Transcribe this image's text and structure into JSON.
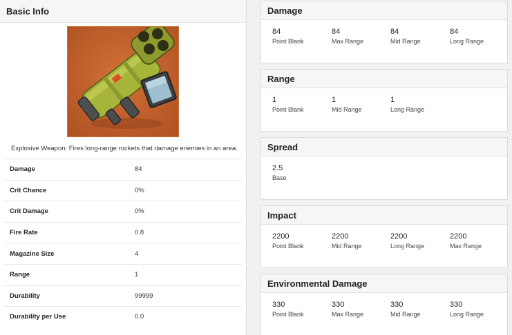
{
  "basic_info": {
    "title": "Basic Info",
    "description": "Explosive Weapon: Fires long-range rockets that damage enemies in an area.",
    "stats": [
      {
        "label": "Damage",
        "value": "84"
      },
      {
        "label": "Crit Chance",
        "value": "0%"
      },
      {
        "label": "Crit Damage",
        "value": "0%"
      },
      {
        "label": "Fire Rate",
        "value": "0.8"
      },
      {
        "label": "Magazine Size",
        "value": "4"
      },
      {
        "label": "Range",
        "value": "1"
      },
      {
        "label": "Durability",
        "value": "99999"
      },
      {
        "label": "Durability per Use",
        "value": "0.0"
      }
    ]
  },
  "cards": {
    "damage": {
      "title": "Damage",
      "metrics": [
        {
          "value": "84",
          "label": "Point Blank"
        },
        {
          "value": "84",
          "label": "Max Range"
        },
        {
          "value": "84",
          "label": "Mid Range"
        },
        {
          "value": "84",
          "label": "Long Range"
        }
      ]
    },
    "range": {
      "title": "Range",
      "metrics": [
        {
          "value": "1",
          "label": "Point Blank"
        },
        {
          "value": "1",
          "label": "Mid Range"
        },
        {
          "value": "1",
          "label": "Long Range"
        }
      ]
    },
    "spread": {
      "title": "Spread",
      "metrics": [
        {
          "value": "2.5",
          "label": "Base"
        }
      ]
    },
    "impact": {
      "title": "Impact",
      "metrics": [
        {
          "value": "2200",
          "label": "Point Blank"
        },
        {
          "value": "2200",
          "label": "Mid Range"
        },
        {
          "value": "2200",
          "label": "Long Range"
        },
        {
          "value": "2200",
          "label": "Max Range"
        }
      ]
    },
    "environmental": {
      "title": "Environmental Damage",
      "metrics": [
        {
          "value": "330",
          "label": "Point Blank"
        },
        {
          "value": "330",
          "label": "Max Range"
        },
        {
          "value": "330",
          "label": "Mid Range"
        },
        {
          "value": "330",
          "label": "Long Range"
        }
      ]
    }
  },
  "colors": {
    "image_background": "#c2612b",
    "launcher_body": "#a7b43a"
  }
}
